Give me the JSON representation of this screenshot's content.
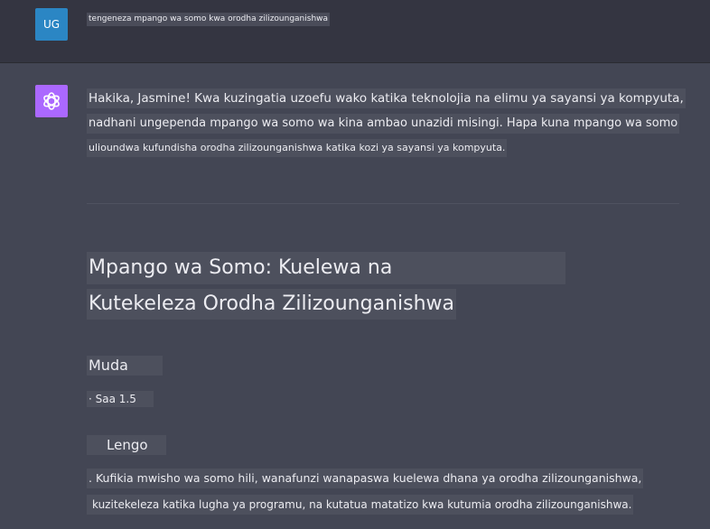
{
  "user_message": {
    "avatar_initials": "UG",
    "text": "tengeneza mpango wa somo kwa orodha zilizounganishwa"
  },
  "assistant_message": {
    "avatar_icon": "openai-logo-icon",
    "intro_line1": "Hakika, Jasmine! Kwa kuzingatia uzoefu wako katika teknolojia na elimu ya sayansi ya kompyuta,",
    "intro_line2": "nadhani ungependa mpango wa somo wa kina ambao unazidi misingi. Hapa kuna mpango wa somo",
    "intro_line3": "ulioundwa kufundisha orodha zilizounganishwa katika kozi ya sayansi ya kompyuta.",
    "title_line1": "Mpango wa Somo: Kuelewa na",
    "title_line2": "Kutekeleza Orodha Zilizounganishwa",
    "duration_heading": "Muda",
    "duration_value": "· Saa 1.5",
    "objective_heading": "Lengo",
    "objective_line1": ". Kufikia mwisho wa somo hili, wanafunzi wanapaswa kuelewa dhana ya orodha zilizounganishwa,",
    "objective_line2": "kuzitekeleza katika lugha ya programu, na kutatua matatizo kwa kutumia orodha zilizounganishwa."
  },
  "colors": {
    "user_avatar_bg": "#2b86c4",
    "bot_avatar_bg": "#ab68ff",
    "user_row_bg": "#343541",
    "assistant_row_bg": "#434654"
  }
}
